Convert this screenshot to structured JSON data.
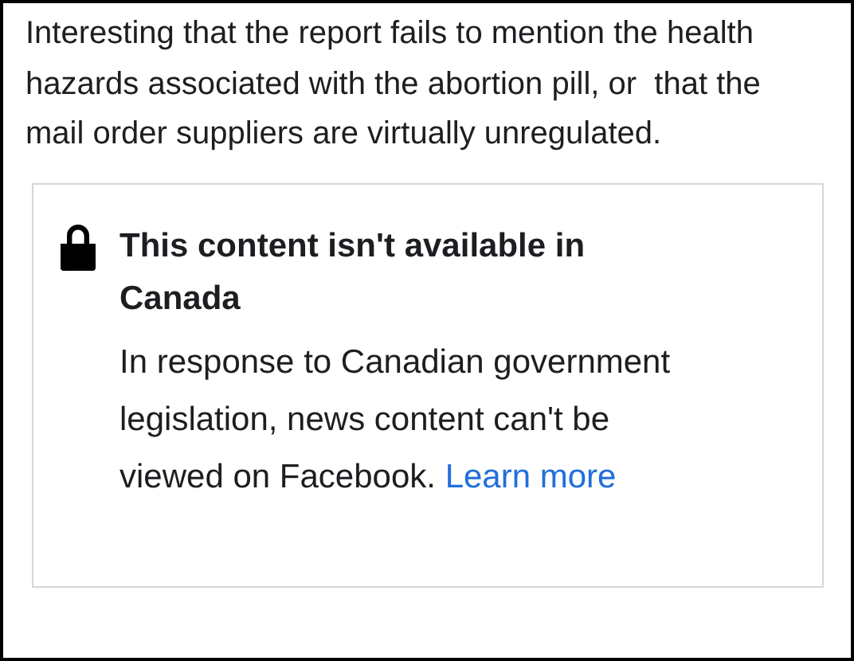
{
  "comment": {
    "text": "Interesting that the report fails to mention the health hazards associated with the abortion pill, or  that the mail order suppliers are virtually unregulated."
  },
  "notice": {
    "title": "This content isn't available in Canada",
    "body": "In response to Canadian government legislation, news content can't be viewed on Facebook.",
    "link": "Learn more"
  }
}
